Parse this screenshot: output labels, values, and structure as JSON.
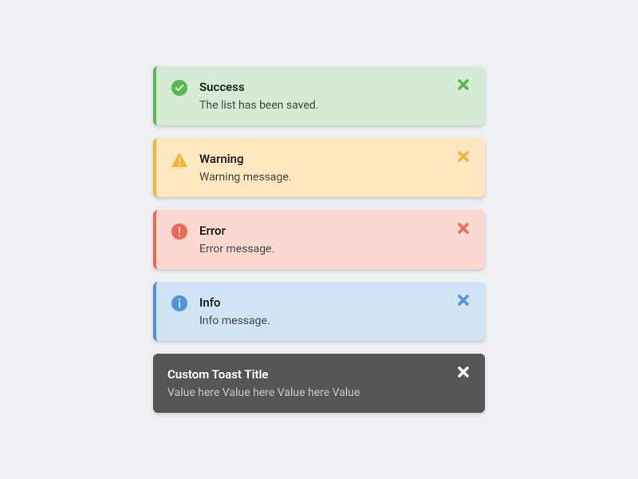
{
  "toasts": [
    {
      "type": "success",
      "title": "Success",
      "message": "The list has been saved."
    },
    {
      "type": "warning",
      "title": "Warning",
      "message": "Warning message."
    },
    {
      "type": "error",
      "title": "Error",
      "message": "Error message."
    },
    {
      "type": "info",
      "title": "Info",
      "message": "Info message."
    },
    {
      "type": "dark",
      "title": "Custom Toast Title",
      "message": "Value here Value here Value here Value"
    }
  ]
}
